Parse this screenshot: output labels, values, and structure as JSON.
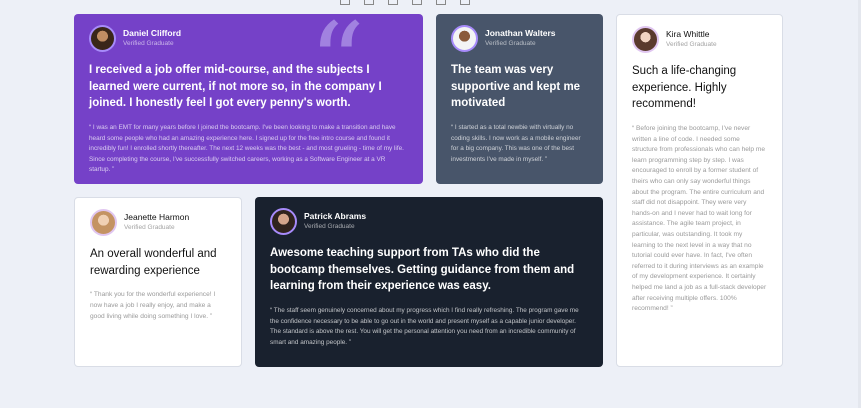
{
  "quote_glyph": "“",
  "testimonials": [
    {
      "name": "Daniel Clifford",
      "status": "Verified Graduate",
      "headline": "I received a job offer mid-course, and the subjects I learned were current, if not more so, in the company I joined. I honestly feel I got every penny's worth.",
      "quote": "“ I was an EMT for many years before I joined the bootcamp. I've been looking to make a transition and have heard some people who had an amazing experience here. I signed up for the free intro course and found it incredibly fun! I enrolled shortly thereafter. The next 12 weeks was the best - and most grueling - time of my life. Since completing the course, I've successfully switched careers, working as a Software Engineer at a VR startup. ”"
    },
    {
      "name": "Jonathan Walters",
      "status": "Verified Graduate",
      "headline": "The team was very supportive and kept me motivated",
      "quote": "“ I started as a total newbie with virtually no coding skills. I now work as a mobile engineer for a big company. This was one of the best investments I've made in myself. ”"
    },
    {
      "name": "Kira Whittle",
      "status": "Verified Graduate",
      "headline": "Such a life-changing experience. Highly recommend!",
      "quote": "“ Before joining the bootcamp, I've never written a line of code. I needed some structure from professionals who can help me learn programming step by step. I was encouraged to enroll by a former student of theirs who can only say wonderful things about the program. The entire curriculum and staff did not disappoint. They were very hands-on and I never had to wait long for assistance. The agile team project, in particular, was outstanding. It took my learning to the next level in a way that no tutorial could ever have. In fact, I've often referred to it during interviews as an example of my development experience. It certainly helped me land a job as a full-stack developer after receiving multiple offers. 100% recommend! ”"
    },
    {
      "name": "Jeanette Harmon",
      "status": "Verified Graduate",
      "headline": "An overall wonderful and rewarding experience",
      "quote": "“ Thank you for the wonderful experience! I now have a job I really enjoy, and make a good living while doing something I love. ”"
    },
    {
      "name": "Patrick Abrams",
      "status": "Verified Graduate",
      "headline": "Awesome teaching support from TAs who did the bootcamp themselves. Getting guidance from them and learning from their experience was easy.",
      "quote": "“ The staff seem genuinely concerned about my progress which I find really refreshing. The program gave me the confidence necessary to be able to go out in the world and present myself as a capable junior developer. The standard is above the rest. You will get the personal attention you need from an incredible community of smart and amazing people. ”"
    }
  ]
}
